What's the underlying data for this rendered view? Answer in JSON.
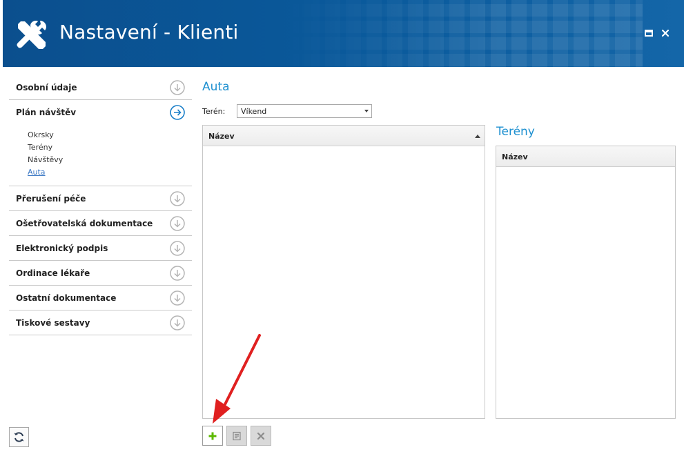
{
  "window": {
    "title": "Nastavení - Klienti",
    "header_color": "#0a5599"
  },
  "sidebar": {
    "items": [
      {
        "label": "Osobní údaje",
        "icon": "chevron-down-circle-icon"
      },
      {
        "label": "Plán návštěv",
        "icon": "arrow-right-circle-icon",
        "expanded": true,
        "subitems": [
          "Okrsky",
          "Terény",
          "Návštěvy",
          "Auta"
        ],
        "active_subitem": "Auta"
      },
      {
        "label": "Přerušení péče",
        "icon": "chevron-down-circle-icon"
      },
      {
        "label": "Ošetřovatelská dokumentace",
        "icon": "chevron-down-circle-icon"
      },
      {
        "label": "Elektronický podpis",
        "icon": "chevron-down-circle-icon"
      },
      {
        "label": "Ordinace lékaře",
        "icon": "chevron-down-circle-icon"
      },
      {
        "label": "Ostatní dokumentace",
        "icon": "chevron-down-circle-icon"
      },
      {
        "label": "Tiskové sestavy",
        "icon": "chevron-down-circle-icon"
      }
    ],
    "refresh_icon": "refresh-icon"
  },
  "main": {
    "section_title": "Auta",
    "teren_label": "Terén:",
    "teren_value": "Víkend",
    "auta_grid": {
      "columns": [
        "Název"
      ],
      "rows": [],
      "sort": "ascending"
    },
    "tereny_title": "Terény",
    "tereny_grid": {
      "columns": [
        "Název"
      ],
      "rows": []
    },
    "toolbar": {
      "add_icon": "plus-icon",
      "edit_icon": "edit-icon",
      "delete_icon": "delete-icon",
      "add_color": "#5cb800"
    }
  },
  "annotation": {
    "type": "red-arrow",
    "color": "#e02020",
    "target": "add-button"
  }
}
